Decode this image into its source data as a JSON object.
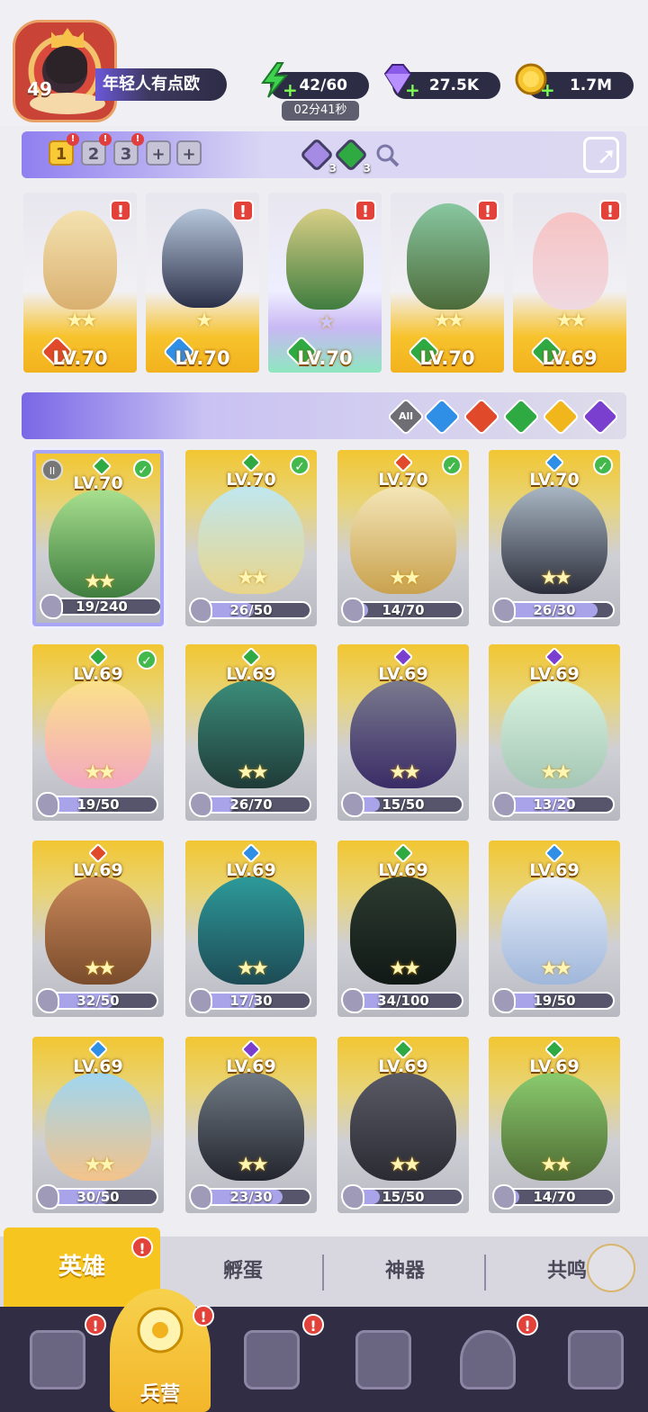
{
  "player": {
    "level": "49",
    "name": "年轻人有点欧"
  },
  "resources": {
    "energy": "42/60",
    "energy_timer": "02分41秒",
    "gems": "27.5K",
    "gold": "1.7M"
  },
  "teams": {
    "slots": [
      "1",
      "2",
      "3",
      "+",
      "+"
    ],
    "active_index": 0,
    "alert": "!",
    "gem_counts": [
      "3",
      "3"
    ]
  },
  "team_row": [
    {
      "level": "LV.70",
      "element": "fire",
      "color": "#e04a2b"
    },
    {
      "level": "LV.70",
      "element": "water",
      "color": "#2f8ee6"
    },
    {
      "level": "LV.70",
      "element": "nature",
      "color": "#2faa43"
    },
    {
      "level": "LV.70",
      "element": "nature",
      "color": "#2faa43"
    },
    {
      "level": "LV.69",
      "element": "nature",
      "color": "#2faa43"
    }
  ],
  "filters": {
    "all_label": "All",
    "elements": [
      {
        "name": "water",
        "color": "#2f8ee6"
      },
      {
        "name": "fire",
        "color": "#e04a2b"
      },
      {
        "name": "nature",
        "color": "#2faa43"
      },
      {
        "name": "light",
        "color": "#f2b61d"
      },
      {
        "name": "dark",
        "color": "#7b3fd0"
      }
    ]
  },
  "heroes": [
    {
      "level": "LV.70",
      "shards": "19/240",
      "progress": 0.08,
      "element_color": "#2faa43",
      "check": true
    },
    {
      "level": "LV.70",
      "shards": "26/50",
      "progress": 0.52,
      "element_color": "#2faa43",
      "check": true
    },
    {
      "level": "LV.70",
      "shards": "14/70",
      "progress": 0.2,
      "element_color": "#e04a2b",
      "check": true
    },
    {
      "level": "LV.70",
      "shards": "26/30",
      "progress": 0.87,
      "element_color": "#2f8ee6",
      "check": true
    },
    {
      "level": "LV.69",
      "shards": "19/50",
      "progress": 0.38,
      "element_color": "#2faa43",
      "check": true
    },
    {
      "level": "LV.69",
      "shards": "26/70",
      "progress": 0.37,
      "element_color": "#2faa43",
      "check": false
    },
    {
      "level": "LV.69",
      "shards": "15/50",
      "progress": 0.3,
      "element_color": "#7b3fd0",
      "check": false
    },
    {
      "level": "LV.69",
      "shards": "13/20",
      "progress": 0.65,
      "element_color": "#7b3fd0",
      "check": false
    },
    {
      "level": "LV.69",
      "shards": "32/50",
      "progress": 0.64,
      "element_color": "#e04a2b",
      "check": false
    },
    {
      "level": "LV.69",
      "shards": "17/30",
      "progress": 0.57,
      "element_color": "#2f8ee6",
      "check": false
    },
    {
      "level": "LV.69",
      "shards": "34/100",
      "progress": 0.34,
      "element_color": "#2faa43",
      "check": false
    },
    {
      "level": "LV.69",
      "shards": "19/50",
      "progress": 0.38,
      "element_color": "#2f8ee6",
      "check": false
    },
    {
      "level": "LV.69",
      "shards": "30/50",
      "progress": 0.6,
      "element_color": "#2f8ee6",
      "check": false
    },
    {
      "level": "LV.69",
      "shards": "23/30",
      "progress": 0.77,
      "element_color": "#7b3fd0",
      "check": false
    },
    {
      "level": "LV.69",
      "shards": "15/50",
      "progress": 0.3,
      "element_color": "#2faa43",
      "check": false
    },
    {
      "level": "LV.69",
      "shards": "14/70",
      "progress": 0.2,
      "element_color": "#2faa43",
      "check": false
    }
  ],
  "subtabs": [
    "英雄",
    "孵蛋",
    "神器",
    "共鸣"
  ],
  "subtab_alert": "!",
  "nav": {
    "active_label": "兵营",
    "alert": "!"
  }
}
